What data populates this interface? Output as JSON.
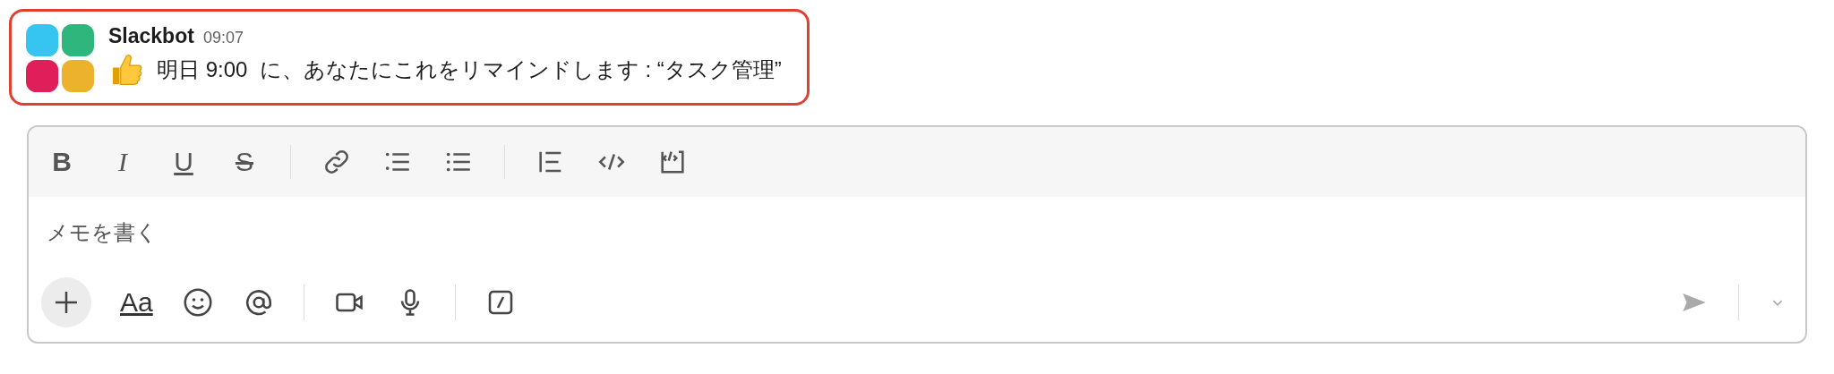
{
  "message": {
    "author": "Slackbot",
    "time": "09:07",
    "text": "明日 9:00  に、あなたにこれをリマインドします : “タスク管理”",
    "highlighted": true
  },
  "composer": {
    "format_buttons": [
      {
        "kind": "bold",
        "label": "B"
      },
      {
        "kind": "italic",
        "label": "I"
      },
      {
        "kind": "underline",
        "label": "U"
      },
      {
        "kind": "strike",
        "label": "S"
      }
    ],
    "placeholder": "メモを書く",
    "text_format_label": "Aa",
    "send_enabled": false
  }
}
